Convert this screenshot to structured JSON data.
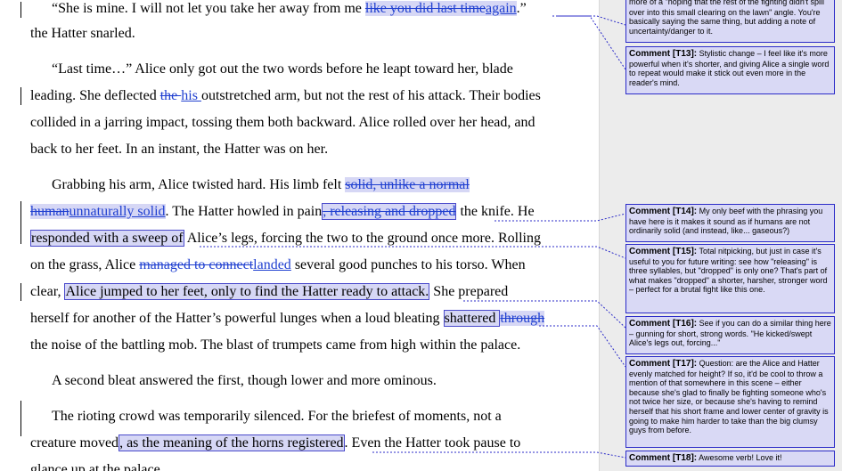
{
  "doc": {
    "lines": [
      {
        "segs": [
          {
            "t": "“She is mine. I will not let you take her away from me "
          },
          {
            "t": "like you did last time",
            "c": "del hl"
          },
          {
            "t": "again",
            "c": "ins hl"
          },
          {
            "t": ".”"
          }
        ]
      },
      {
        "segs": [
          {
            "t": "the Hatter snarled."
          }
        ]
      },
      {
        "segs": [
          {
            "t": "“Last time…” Alice only got out the two words before he leapt toward her, blade"
          }
        ]
      },
      {
        "segs": [
          {
            "t": "leading. She deflected "
          },
          {
            "t": "the ",
            "c": "del"
          },
          {
            "t": "his ",
            "c": "ins"
          },
          {
            "t": "outstretched arm, but not the rest of his attack. Their bodies"
          }
        ]
      },
      {
        "segs": [
          {
            "t": "collided in a jarring impact, tossing them both backward. Alice rolled over her head, and"
          }
        ]
      },
      {
        "segs": [
          {
            "t": "back to her feet. In an instant, the Hatter was on her."
          }
        ]
      },
      {
        "segs": [
          {
            "t": "Grabbing his arm, Alice twisted hard. His limb felt "
          },
          {
            "t": "solid, unlike a normal",
            "c": "del hl"
          }
        ]
      },
      {
        "segs": [
          {
            "t": "human",
            "c": "del hl"
          },
          {
            "t": "unnaturally solid",
            "c": "ins hl"
          },
          {
            "t": ". The Hatter howled in pain"
          },
          {
            "t": ", releasing and dropped",
            "c": "del hl box"
          },
          {
            "t": " the knife. He"
          }
        ]
      },
      {
        "segs": [
          {
            "t": "responded with a sweep of",
            "c": "hl box"
          },
          {
            "t": " Alice’s legs, forcing the two to the ground once more. Rolling"
          }
        ]
      },
      {
        "segs": [
          {
            "t": "on the grass, Alice "
          },
          {
            "t": "managed to connect",
            "c": "del"
          },
          {
            "t": "landed",
            "c": "ins"
          },
          {
            "t": " several good punches to his torso. When"
          }
        ]
      },
      {
        "segs": [
          {
            "t": "clear, "
          },
          {
            "t": "Alice jumped to her feet, only to find the Hatter ready to attack.",
            "c": "hl box"
          },
          {
            "t": " She prepared"
          }
        ]
      },
      {
        "segs": [
          {
            "t": "herself for another of the Hatter’s powerful lunges when a loud bleating "
          },
          {
            "t": "shattered ",
            "c": "hl box"
          },
          {
            "t": "through",
            "c": "del hl"
          }
        ]
      },
      {
        "segs": [
          {
            "t": "the noise of the battling mob. The blast of trumpets came from high within the palace."
          }
        ]
      },
      {
        "segs": [
          {
            "t": "A second bleat answered the first, though lower and more ominous."
          }
        ]
      },
      {
        "segs": [
          {
            "t": "The rioting crowd was temporarily silenced. For the briefest of moments, not a"
          }
        ]
      },
      {
        "segs": [
          {
            "t": "creature moved"
          },
          {
            "t": ", as the meaning of the horns registered",
            "c": "hl box"
          },
          {
            "t": ". Even the Hatter took pause to"
          }
        ]
      },
      {
        "segs": [
          {
            "t": "glance up at the palace."
          }
        ]
      }
    ]
  },
  "comments": [
    {
      "label": "",
      "text": "more of a \"hoping that the rest of the fighting didn't spill over into this small clearing on the lawn\" angle. You're basically saying the same thing, but adding a note of uncertainty/danger to it."
    },
    {
      "label": "Comment [T13]:",
      "text": "Stylistic change – I feel like it's more powerful when it's shorter, and giving Alice a single word to repeat would make it stick out even more in the reader's mind."
    },
    {
      "label": "Comment [T14]:",
      "text": "My only beef with the phrasing you have here is it makes it sound as if humans are not ordinarily solid (and instead, like... gaseous?)"
    },
    {
      "label": "Comment [T15]:",
      "text": "Total nitpicking, but just in case it's useful to you for future writing: see how \"releasing\" is three syllables, but \"dropped\" is only one? That's part of what makes \"dropped\" a shorter, harsher, stronger word – perfect for a brutal fight like this one."
    },
    {
      "label": "Comment [T16]:",
      "text": "See if you can do a similar thing here – gunning for short, strong words. \"He kicked/swept Alice's legs out, forcing...\""
    },
    {
      "label": "Comment [T17]:",
      "text": "Question: are the Alice and Hatter evenly matched for height? If so, it'd be cool to throw a mention of that somewhere in this scene – either because she's glad to finally be fighting someone who's not twice her size, or because she's having to remind herself that his short frame and lower center of gravity is going to make him harder to take than the big clumsy guys from before."
    },
    {
      "label": "Comment [T18]:",
      "text": "Awesome verb! Love it!"
    }
  ]
}
